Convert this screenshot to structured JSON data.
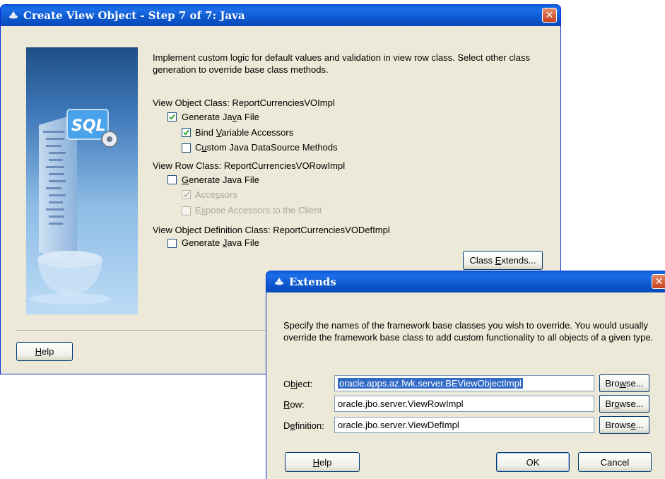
{
  "wizard": {
    "title": "Create View Object - Step 7 of 7: Java",
    "close_glyph": "✕",
    "intro": "Implement custom logic for default values and validation in view row class.  Select other class generation to override base class methods.",
    "vo_class": {
      "label": "View Object Class: ReportCurrenciesVOImpl",
      "gen_java": {
        "pre": "Generate Ja",
        "u": "v",
        "post": "a File",
        "checked": true
      },
      "bind_vars": {
        "pre": "Bind ",
        "u": "V",
        "post": "ariable Accessors",
        "checked": true
      },
      "custom_ds": {
        "pre": "C",
        "u": "u",
        "post": "stom Java DataSource Methods",
        "checked": false
      }
    },
    "row_class": {
      "label": "View Row Class: ReportCurrenciesVORowImpl",
      "gen_java": {
        "pre": "",
        "u": "G",
        "post": "enerate Java File",
        "checked": false
      },
      "accessors": {
        "pre": "Acce",
        "u": "s",
        "post": "sors",
        "checked": true,
        "disabled": true
      },
      "expose": {
        "pre": "E",
        "u": "x",
        "post": "pose Accessors to the Client",
        "checked": false,
        "disabled": true
      }
    },
    "def_class": {
      "label": "View Object Definition Class: ReportCurrenciesVODefImpl",
      "gen_java": {
        "pre": "Generate ",
        "u": "J",
        "post": "ava File",
        "checked": false
      }
    },
    "class_extends_btn": {
      "pre": "Class ",
      "u": "E",
      "post": "xtends..."
    },
    "help_btn": {
      "pre": "",
      "u": "H",
      "post": "elp"
    }
  },
  "extends_dialog": {
    "title": "Extends",
    "close_glyph": "✕",
    "description": "Specify the names of the framework base classes you wish to override. You would usually override the framework base class to add custom functionality to all objects of a given type.",
    "object": {
      "label_pre": "O",
      "label_u": "b",
      "label_post": "ject:",
      "value": "oracle.apps.az.fwk.server.BEViewObjectImpl",
      "browse": {
        "pre": "Bro",
        "u": "w",
        "post": "se..."
      }
    },
    "row": {
      "label_pre": "",
      "label_u": "R",
      "label_post": "ow:",
      "value": "oracle.jbo.server.ViewRowImpl",
      "browse": {
        "pre": "Br",
        "u": "o",
        "post": "wse..."
      }
    },
    "definition": {
      "label_pre": "D",
      "label_u": "e",
      "label_post": "finition:",
      "value": "oracle.jbo.server.ViewDefImpl",
      "browse": {
        "pre": "Brows",
        "u": "e",
        "post": "..."
      }
    },
    "help_btn": {
      "pre": "",
      "u": "H",
      "post": "elp"
    },
    "ok_btn": "OK",
    "cancel_btn": "Cancel"
  },
  "colors": {
    "title_blue": "#0b55c9",
    "dialog_bg": "#ece9d8",
    "close_red": "#c8421b",
    "selection": "#316ac5"
  }
}
